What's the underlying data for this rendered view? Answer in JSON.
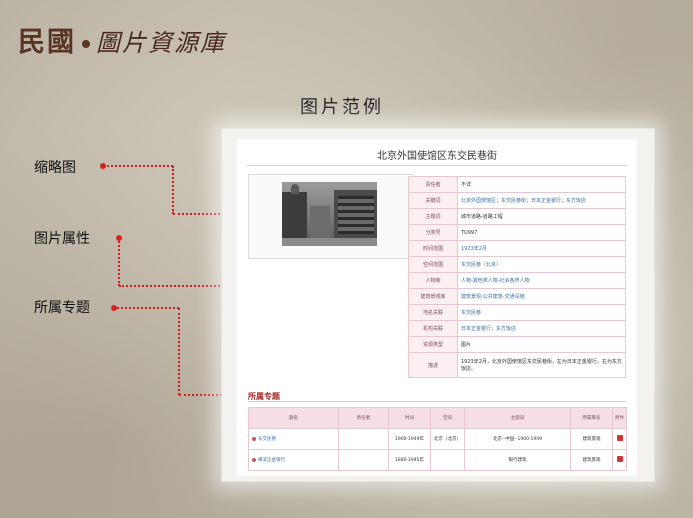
{
  "logo": {
    "main": "民國",
    "sub": "圖片資源庫"
  },
  "slide_title": "图片范例",
  "labels": {
    "thumbnail": "缩略图",
    "attributes": "图片属性",
    "topics": "所属专题"
  },
  "record": {
    "title": "北京外国使馆区东交民巷街",
    "attributes": [
      {
        "key": "责任者",
        "value": "不详"
      },
      {
        "key": "关键词",
        "value": "北京外国使馆区；东交民巷街；日本正金银行；东方饭店"
      },
      {
        "key": "主题词",
        "value": "城市道路-道路工程"
      },
      {
        "key": "分类号",
        "value": "TU997"
      },
      {
        "key": "时间范围",
        "value": "1923年2月"
      },
      {
        "key": "空间范围",
        "value": "东交民巷（北京）"
      },
      {
        "key": "人物库",
        "value": "人物-其他类人物-社会各界人物"
      },
      {
        "key": "建筑景观库",
        "value": "建筑景观-公共建筑-交通设施"
      },
      {
        "key": "地名关联",
        "value": "东交民巷"
      },
      {
        "key": "机构关联",
        "value": "日本正金银行；东方饭店"
      },
      {
        "key": "资源类型",
        "value": "图片"
      },
      {
        "key": "描述",
        "value": "1923年2月，北京外国使馆区东交民巷街，左为日本正金银行，右为东方饭店。"
      }
    ],
    "topics_title": "所属专题",
    "topics_headers": [
      "题名",
      "责任者",
      "时间",
      "空间",
      "主题词",
      "所属库名",
      "附件"
    ],
    "topics_rows": [
      [
        "东交民巷",
        "",
        "1900-1949年",
        "北京（北京）",
        "北京--中国--1900-1949",
        "建筑景观",
        ""
      ],
      [
        "横滨正金银行",
        "",
        "1880-1945年",
        "",
        "银行建筑",
        "建筑景观",
        ""
      ]
    ]
  },
  "colors": {
    "accent_red": "#d02020",
    "link_blue": "#3c6ea5",
    "logo_brown": "#5b3323",
    "table_border": "#e7c7cf"
  }
}
